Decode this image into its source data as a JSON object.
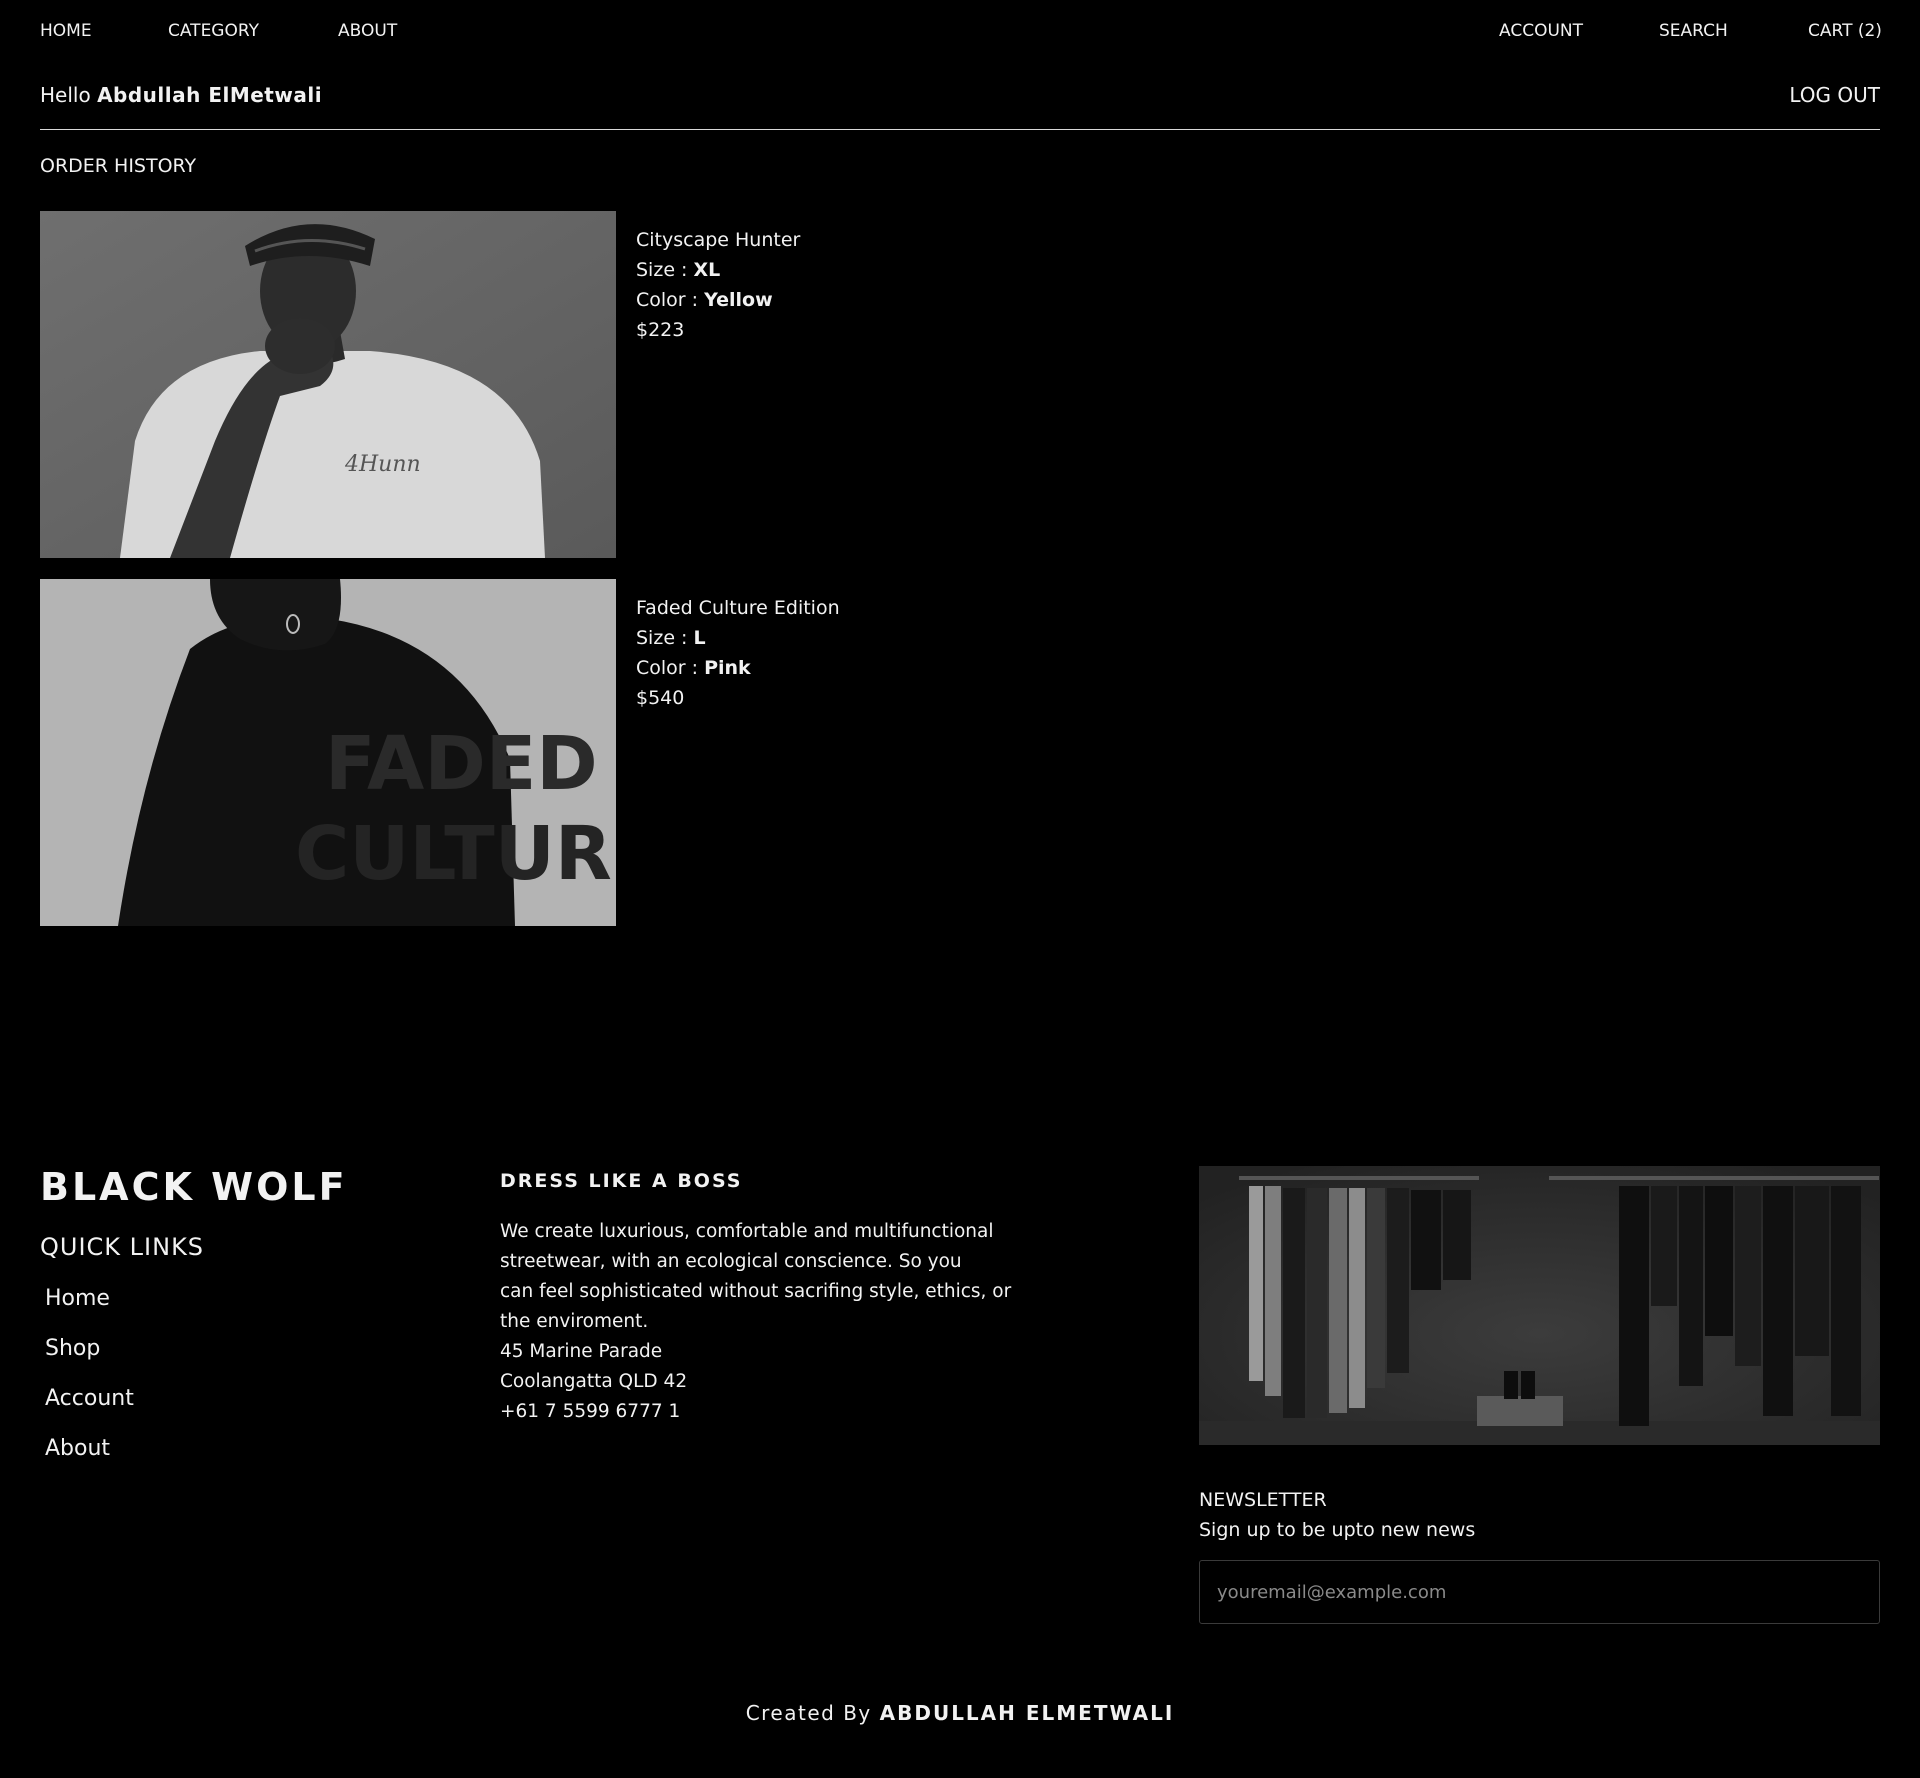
{
  "nav": {
    "home": "HOME",
    "category": "CATEGORY",
    "about": "ABOUT",
    "account": "ACCOUNT",
    "search": "SEARCH",
    "cart": "CART (2)"
  },
  "greeting": {
    "prefix": "Hello",
    "name": "Abdullah ElMetwali",
    "logout": "LOG OUT"
  },
  "order_history": {
    "title": "ORDER HISTORY",
    "orders": [
      {
        "name": "Cityscape Hunter",
        "size_label": "Size :",
        "size": "XL",
        "color_label": "Color :",
        "color": "Yellow",
        "price": "$223"
      },
      {
        "name": "Faded Culture Edition",
        "size_label": "Size :",
        "size": "L",
        "color_label": "Color :",
        "color": "Pink",
        "price": "$540"
      }
    ]
  },
  "footer": {
    "brand": "BLACK WOLF",
    "quick_links_title": "QUICK LINKS",
    "quick_links": [
      "Home",
      "Shop",
      "Account",
      "About"
    ],
    "boss_title": "DRESS LIKE A BOSS",
    "boss_lines": [
      "We create luxurious, comfortable and multifunctional",
      "streetwear, with an ecological conscience. So you",
      "can feel sophisticated without sacrifing style, ethics, or",
      "the enviroment.",
      "45 Marine Parade",
      "Coolangatta QLD 42",
      "+61 7 5599 6777 1"
    ],
    "newsletter_title": "NEWSLETTER",
    "newsletter_sub": "Sign up to be upto new news",
    "newsletter_placeholder": "youremail@example.com",
    "credit_prefix": "Created By",
    "credit_name": "ABDULLAH ELMETWALI"
  }
}
